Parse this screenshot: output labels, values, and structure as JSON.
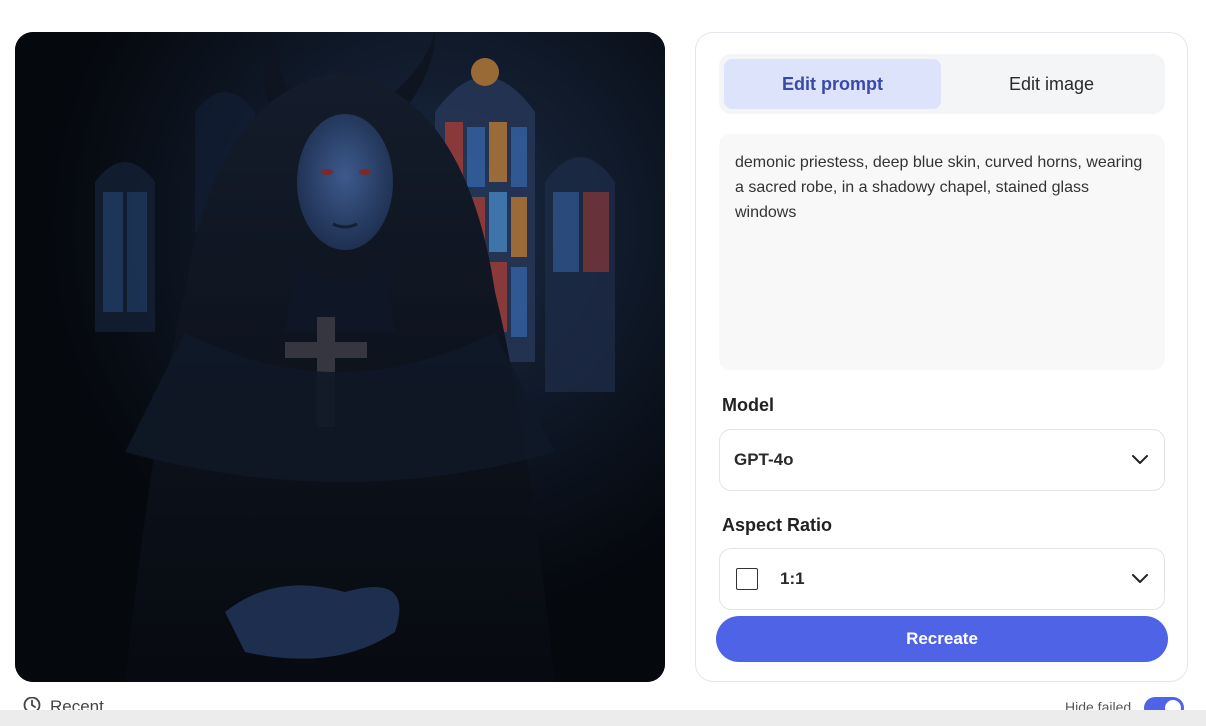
{
  "image": {
    "alt": "demonic priestess, deep blue skin, curved horns, wearing a sacred robe, in a shadowy chapel, stained glass windows"
  },
  "tabs": [
    {
      "label": "Edit prompt",
      "active": true
    },
    {
      "label": "Edit image",
      "active": false
    }
  ],
  "prompt": {
    "value": "demonic priestess, deep blue skin, curved horns, wearing a sacred robe, in a shadowy chapel, stained glass windows"
  },
  "model": {
    "label": "Model",
    "selected": "GPT-4o"
  },
  "aspect_ratio": {
    "label": "Aspect Ratio",
    "selected": "1:1"
  },
  "actions": {
    "recreate_label": "Recreate"
  },
  "footer": {
    "recent_label": "Recent",
    "hide_failed_label": "Hide failed",
    "hide_failed_on": true
  },
  "colors": {
    "accent": "#4f63e7",
    "tab_active_bg": "#dde3fb",
    "tab_active_text": "#3949ab"
  },
  "icons": {
    "recent": "history-icon",
    "select": "chevron-down-icon",
    "ratio": "square-ratio-icon"
  }
}
